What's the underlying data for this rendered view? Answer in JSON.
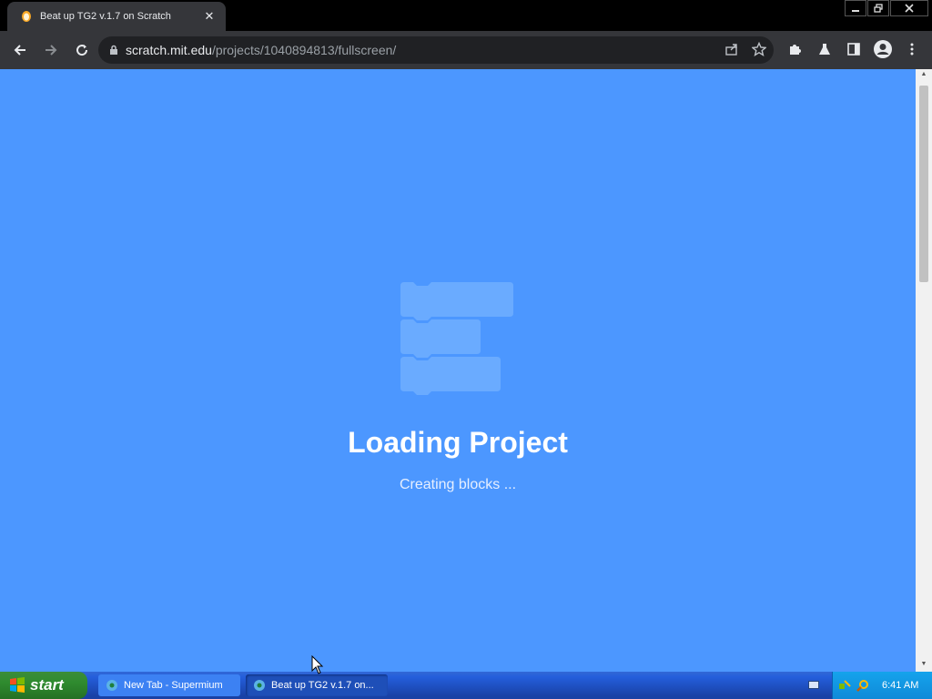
{
  "browser": {
    "tab_title": "Beat up TG2 v.1.7 on Scratch",
    "tab_close": "✕",
    "url_host": "scratch.mit.edu",
    "url_path": "/projects/1040894813/fullscreen/"
  },
  "page": {
    "loading_title": "Loading Project",
    "loading_status": "Creating blocks ..."
  },
  "taskbar": {
    "start_label": "start",
    "tasks": [
      {
        "label": "New Tab - Supermium"
      },
      {
        "label": "Beat up TG2 v.1.7 on..."
      }
    ],
    "clock": "6:41 AM"
  },
  "colors": {
    "page_bg": "#4c97ff",
    "chrome_bg": "#35363a",
    "taskbar_blue": "#245edb",
    "start_green": "#2f8b2f"
  }
}
